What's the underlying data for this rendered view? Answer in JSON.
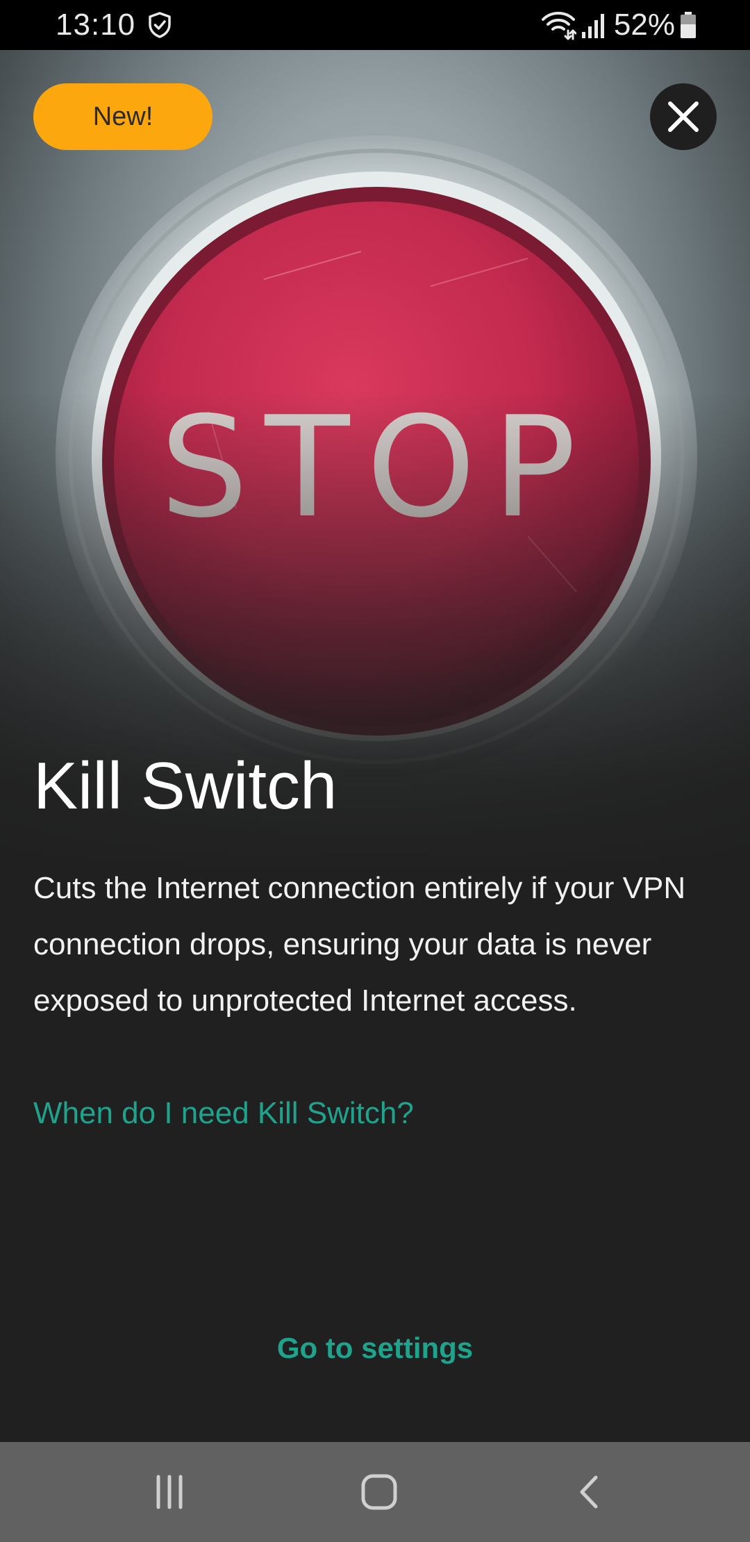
{
  "status_bar": {
    "time": "13:10",
    "battery": "52%",
    "icons": [
      "vpn-shield-icon",
      "wifi-icon",
      "signal-icon",
      "battery-icon"
    ]
  },
  "badge": {
    "label": "New!",
    "color": "#fca70d"
  },
  "hero": {
    "button_text": "STOP"
  },
  "content": {
    "title": "Kill Switch",
    "description": "Cuts the Internet connection entirely if your VPN connection drops, ensuring your data is never exposed to unprotected Internet access.",
    "help_link": "When do I need Kill Switch?",
    "accent_color": "#1fa38d"
  },
  "actions": {
    "settings": "Go to settings"
  },
  "nav_bar": {
    "icons": [
      "recent-apps-icon",
      "home-icon",
      "back-icon"
    ]
  }
}
